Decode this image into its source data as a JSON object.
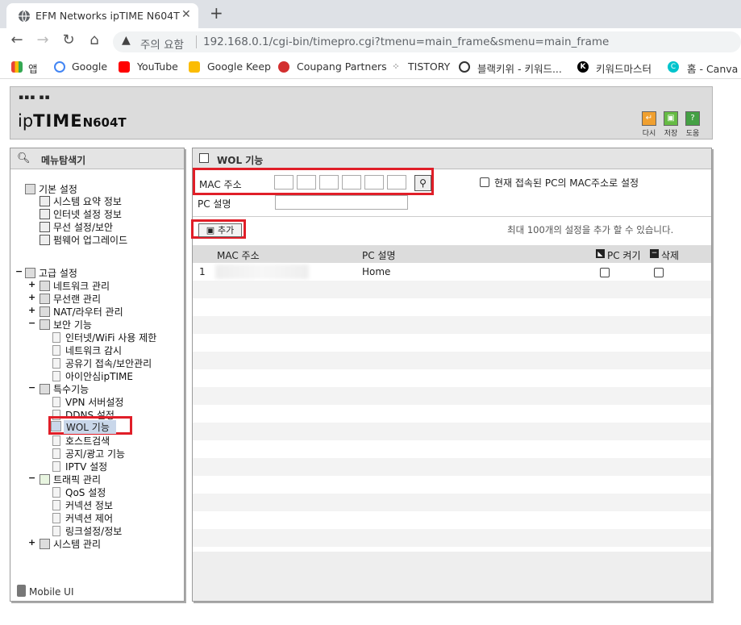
{
  "browser": {
    "tab_title": "EFM Networks ipTIME N604T",
    "security_label": "주의 요함",
    "url": "192.168.0.1/cgi-bin/timepro.cgi?tmenu=main_frame&smenu=main_frame",
    "bookmarks": [
      {
        "label": "앱",
        "icon": "apps-icon",
        "color": "#4285f4"
      },
      {
        "label": "Google",
        "icon": "google-icon",
        "color": "#ea4335"
      },
      {
        "label": "YouTube",
        "icon": "youtube-icon",
        "color": "#ff0000"
      },
      {
        "label": "Google Keep",
        "icon": "keep-icon",
        "color": "#fbbc04"
      },
      {
        "label": "Coupang Partners",
        "icon": "coupang-icon",
        "color": "#d32f2f"
      },
      {
        "label": "TISTORY",
        "icon": "tistory-icon",
        "color": "#222222"
      },
      {
        "label": "블랙키위 - 키워드...",
        "icon": "blackkiwi-icon",
        "color": "#222222"
      },
      {
        "label": "키워드마스터",
        "icon": "keywordmaster-icon",
        "color": "#000000"
      },
      {
        "label": "홈 - Canva",
        "icon": "canva-icon",
        "color": "#00c4cc"
      }
    ]
  },
  "router": {
    "logo_top": "▪▪▪ ▪▪",
    "logo_prefix": "ip",
    "logo_brand": "TIME",
    "model": "N604T",
    "header_buttons": [
      {
        "label": "다시",
        "icon": "undo-icon",
        "color": "#f0a030"
      },
      {
        "label": "저장",
        "icon": "save-icon",
        "color": "#66bb44"
      },
      {
        "label": "도움",
        "icon": "help-icon",
        "color": "#44a044"
      }
    ]
  },
  "left_panel": {
    "title": "메뉴탐색기",
    "basic_title": "기본 설정",
    "basic_items": [
      "시스템 요약 정보",
      "인터넷 설정 정보",
      "무선 설정/보안",
      "펌웨어 업그레이드"
    ],
    "advanced_title": "고급 설정",
    "advanced_groups": [
      "네트워크 관리",
      "무선랜 관리",
      "NAT/라우터 관리"
    ],
    "security_title": "보안 기능",
    "security_items": [
      "인터넷/WiFi 사용 제한",
      "네트워크 감시",
      "공유기 접속/보안관리",
      "아이안심ipTIME"
    ],
    "special_title": "특수기능",
    "special_items": [
      "VPN 서버설정",
      "DDNS 설정",
      "WOL 기능",
      "호스트검색",
      "공지/광고 기능",
      "IPTV 설정"
    ],
    "traffic_title": "트래픽 관리",
    "traffic_items": [
      "QoS 설정",
      "커넥션 정보",
      "커넥션 제어",
      "링크설정/정보"
    ],
    "system_title": "시스템 관리",
    "mobile_label": "Mobile UI"
  },
  "right_panel": {
    "title": "WOL 기능",
    "mac_label": "MAC 주소",
    "current_pc_label": "현재 접속된 PC의 MAC주소로 설정",
    "pc_desc_label": "PC 설명",
    "add_label": "추가",
    "limit_note": "최대 100개의 설정을 추가 할 수 있습니다.",
    "columns": {
      "mac": "MAC 주소",
      "desc": "PC 설명",
      "power": "PC 켜기",
      "delete": "삭제"
    },
    "rows": [
      {
        "index": "1",
        "mac": "",
        "desc": "Home"
      }
    ]
  }
}
